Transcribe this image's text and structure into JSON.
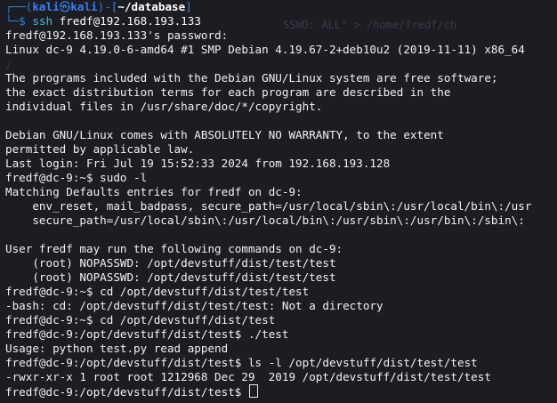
{
  "window": {
    "background": "#1c1c23",
    "text_color": "#f2f2f2",
    "accent": "#2f82d0"
  },
  "prompt": {
    "corner_top": "┌──(",
    "user": "kali",
    "at_symbol": "㉿",
    "host": "kali",
    "mid": ")-[",
    "dir": "~/database",
    "end": "]",
    "corner_bottom": "└─",
    "dollar": "$",
    "command": "ssh",
    "argument": " fredf@192.168.193.133"
  },
  "output": [
    "fredf@192.168.193.133's password:",
    "Linux dc-9 4.19.0-6-amd64 #1 SMP Debian 4.19.67-2+deb10u2 (2019-11-11) x86_64",
    "",
    "The programs included with the Debian GNU/Linux system are free software;",
    "the exact distribution terms for each program are described in the",
    "individual files in /usr/share/doc/*/copyright.",
    "",
    "Debian GNU/Linux comes with ABSOLUTELY NO WARRANTY, to the extent",
    "permitted by applicable law.",
    "Last login: Fri Jul 19 15:52:33 2024 from 192.168.193.128",
    "fredf@dc-9:~$ sudo -l",
    "Matching Defaults entries for fredf on dc-9:",
    "    env_reset, mail_badpass, secure_path=/usr/local/sbin\\:/usr/local/bin\\:/usr",
    "    secure_path=/usr/local/sbin\\:/usr/local/bin\\:/usr/sbin\\:/usr/bin\\:/sbin\\:",
    "",
    "User fredf may run the following commands on dc-9:",
    "    (root) NOPASSWD: /opt/devstuff/dist/test/test",
    "    (root) NOPASSWD: /opt/devstuff/dist/test/test",
    "fredf@dc-9:~$ cd /opt/devstuff/dist/test/test",
    "-bash: cd: /opt/devstuff/dist/test/test: Not a directory",
    "fredf@dc-9:~$ cd /opt/devstuff/dist/test",
    "fredf@dc-9:/opt/devstuff/dist/test$ ./test",
    "Usage: python test.py read append",
    "fredf@dc-9:/opt/devstuff/dist/test$ ls -l /opt/devstuff/dist/test/test",
    "-rwxr-xr-x 1 root root 1212968 Dec 29  2019 /opt/devstuff/dist/test/test"
  ],
  "final_prompt": "fredf@dc-9:/opt/devstuff/dist/test$ ",
  "background_ghost_text": [
    "SSWD: ALL\" > /home/fredf/ch",
    "/"
  ]
}
